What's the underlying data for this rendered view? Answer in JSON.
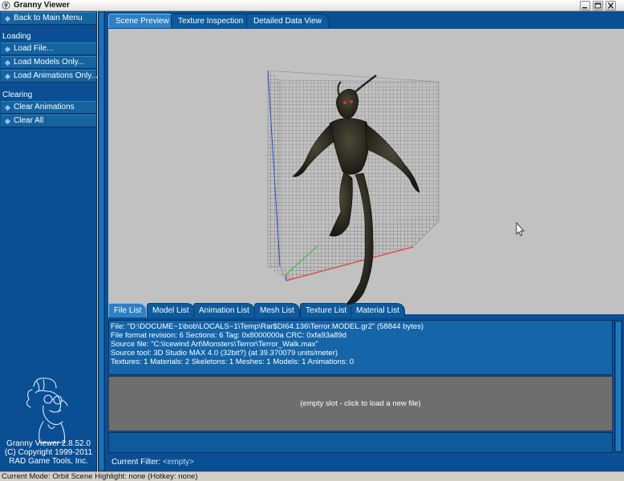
{
  "window": {
    "title": "Granny Viewer"
  },
  "sidebar": {
    "back_label": "Back to Main Menu",
    "loading_header": "Loading",
    "loading_items": [
      "Load File...",
      "Load Models Only...",
      "Load Animations Only..."
    ],
    "clearing_header": "Clearing",
    "clearing_items": [
      "Clear Animations",
      "Clear All"
    ],
    "version_lines": [
      "Granny Viewer 2.8.52.0",
      "(C) Copyright 1999-2011",
      "RAD Game Tools, Inc."
    ]
  },
  "tabs": [
    "Scene Preview",
    "Texture Inspection",
    "Detailed Data View"
  ],
  "active_tab": "Scene Preview",
  "subtabs": [
    "File List",
    "Model List",
    "Animation List",
    "Mesh List",
    "Texture List",
    "Material List"
  ],
  "active_subtab": "File List",
  "file_info": [
    "File: \"D:\\DOCUME~1\\bob\\LOCALS~1\\Temp\\Rar$DI64.136\\Terror.MODEL.gr2\" (58844 bytes)",
    "File format revision: 6    Sections: 6    Tag: 0x8000000a    CRC: 0xfa93a89d",
    "Source file: \"C:\\Icewind Art\\Monsters\\Terror\\Terror_Walk.max\"",
    "Source tool: 3D Studio MAX 4.0 (32bit?) (at 39.370079 units/meter)",
    "Textures: 1    Materials: 2    Skeletons: 1    Meshes: 1    Models: 1    Animations: 0"
  ],
  "empty_slot_text": "(empty slot - click to load a new file)",
  "filter": {
    "label": "Current Filter:",
    "value": "<empty>"
  },
  "status_text": "Current Mode: Orbit Scene    Highlight: none (Hotkey: none)",
  "colors": {
    "panel_blue": "#0a4f93",
    "viewport_gray": "#c1c1c1",
    "empty_slot_gray": "#6e6e6e"
  }
}
